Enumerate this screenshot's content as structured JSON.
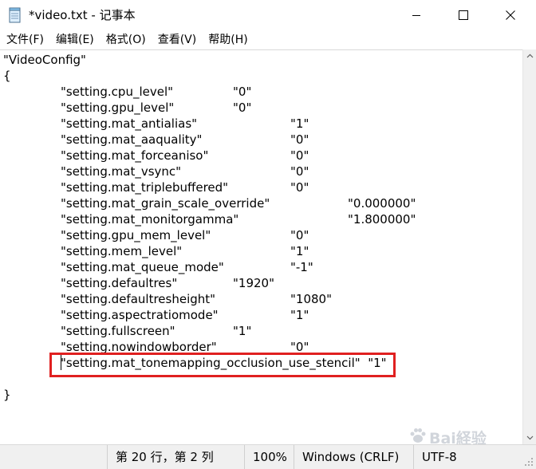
{
  "window": {
    "title": "*video.txt - 记事本"
  },
  "menu": [
    "文件(F)",
    "编辑(E)",
    "格式(O)",
    "查看(V)",
    "帮助(H)"
  ],
  "editor": {
    "lines": [
      "\"VideoConfig\"",
      "{",
      "\"setting.cpu_level\"",
      "\"setting.gpu_level\"",
      "\"setting.mat_antialias\"",
      "\"setting.mat_aaquality\"",
      "\"setting.mat_forceaniso\"",
      "\"setting.mat_vsync\"",
      "\"setting.mat_triplebuffered\"",
      "\"setting.mat_grain_scale_override\"",
      "\"setting.mat_monitorgamma\"",
      "\"setting.gpu_mem_level\"",
      "\"setting.mem_level\"",
      "\"setting.mat_queue_mode\"",
      "\"setting.defaultres\"",
      "\"setting.defaultresheight\"",
      "\"setting.aspectratiomode\"",
      "\"setting.fullscreen\"",
      "\"setting.nowindowborder\"",
      "\"setting.mat_tonemapping_occlusion_use_stencil\"  \"1\"",
      "",
      "}"
    ],
    "values": [
      "",
      "",
      "\"0\"",
      "\"0\"",
      "\"1\"",
      "\"0\"",
      "\"0\"",
      "\"0\"",
      "\"0\"",
      "\"0.000000\"",
      "\"1.800000\"",
      "\"0\"",
      "\"1\"",
      "\"-1\"",
      "\"1920\"",
      "\"1080\"",
      "\"1\"",
      "\"1\"",
      "\"0\"",
      "",
      "",
      ""
    ]
  },
  "status": {
    "position": "第 20 行，第 2 列",
    "zoom": "100%",
    "line_ending": "Windows (CRLF)",
    "encoding": "UTF-8"
  },
  "watermark": {
    "text": "Bai経验"
  }
}
